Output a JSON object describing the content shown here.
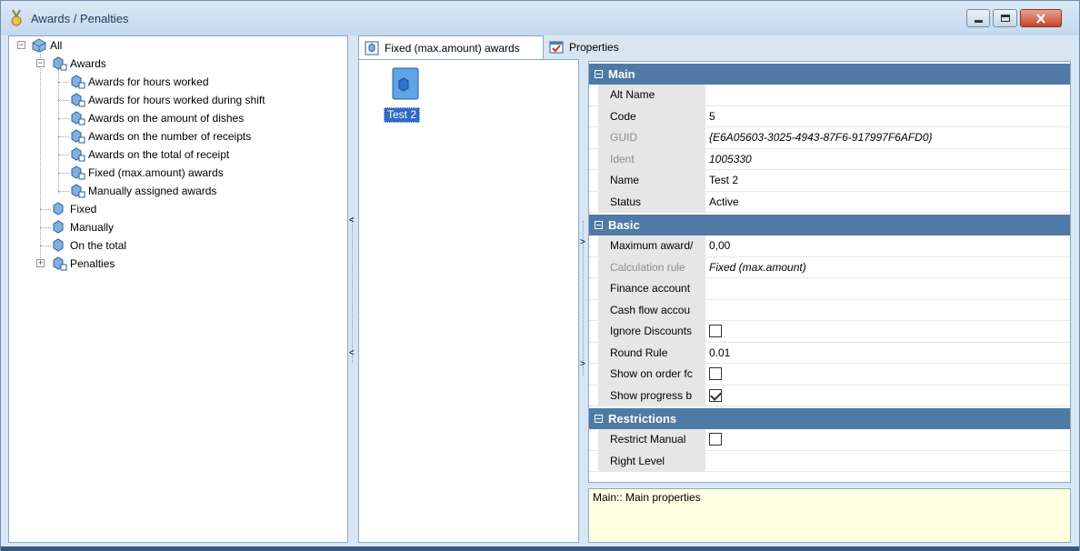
{
  "window": {
    "title": "Awards / Penalties"
  },
  "tree": {
    "root": "All",
    "awards": "Awards",
    "award_children": [
      "Awards for hours worked",
      "Awards for hours worked during shift",
      "Awards on the amount of dishes",
      "Awards on the number of receipts",
      "Awards on the total of receipt",
      "Fixed (max.amount) awards",
      "Manually assigned awards"
    ],
    "siblings": [
      "Fixed",
      "Manually",
      "On the total",
      "Penalties"
    ]
  },
  "tabs": [
    {
      "label": "Fixed (max.amount) awards"
    },
    {
      "label": "Properties"
    }
  ],
  "objects": [
    {
      "label": "Test 2"
    }
  ],
  "properties": {
    "groups": {
      "main": "Main",
      "basic": "Basic",
      "restrictions": "Restrictions"
    },
    "main": [
      {
        "name": "Alt Name",
        "value": ""
      },
      {
        "name": "Code",
        "value": "5"
      },
      {
        "name": "GUID",
        "value": "{E6A05603-3025-4943-87F6-917997F6AFD0}"
      },
      {
        "name": "Ident",
        "value": "1005330"
      },
      {
        "name": "Name",
        "value": "Test 2"
      },
      {
        "name": "Status",
        "value": "Active"
      }
    ],
    "basic": [
      {
        "name": "Maximum award/",
        "value": "0,00"
      },
      {
        "name": "Calculation rule",
        "value": "Fixed (max.amount)"
      },
      {
        "name": "Finance account",
        "value": ""
      },
      {
        "name": "Cash flow accou",
        "value": ""
      },
      {
        "name": "Ignore Discounts",
        "checked": false
      },
      {
        "name": "Round Rule",
        "value": "0.01"
      },
      {
        "name": "Show on order fc",
        "checked": false
      },
      {
        "name": "Show progress b",
        "checked": true
      }
    ],
    "restrictions": [
      {
        "name": "Restrict Manual",
        "checked": false
      },
      {
        "name": "Right Level",
        "value": ""
      }
    ]
  },
  "help": {
    "text": "Main:: Main properties"
  },
  "colors": {
    "group_header": "#4f7aa6",
    "selection": "#3169c6",
    "help_bg": "#ffffe1"
  }
}
